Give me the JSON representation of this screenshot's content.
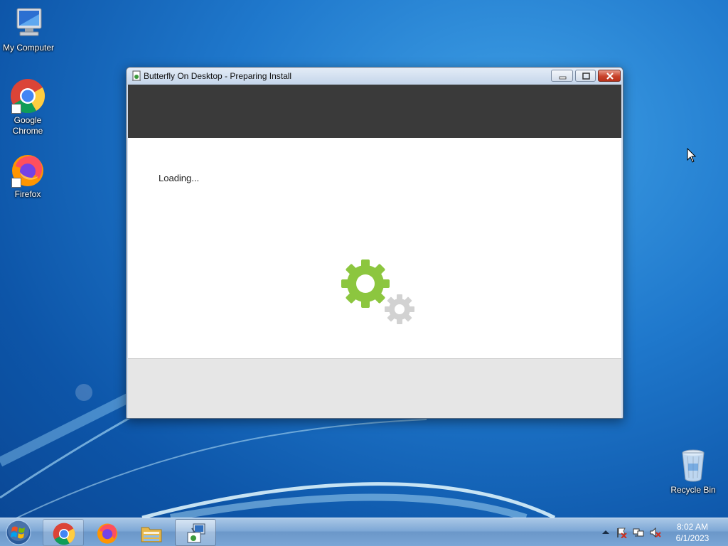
{
  "desktop": {
    "icons": [
      {
        "label": "My Computer",
        "icon": "computer-icon"
      },
      {
        "label": "Google Chrome",
        "icon": "chrome-icon"
      },
      {
        "label": "Firefox",
        "icon": "firefox-icon"
      },
      {
        "label": "Recycle Bin",
        "icon": "recycle-bin-icon"
      }
    ]
  },
  "window": {
    "title": "Butterfly On Desktop - Preparing Install",
    "status_text": "Loading...",
    "controls": [
      "minimize",
      "maximize",
      "close"
    ]
  },
  "taskbar": {
    "start_icon": "windows-logo-icon",
    "pinned": [
      {
        "name": "Google Chrome",
        "icon": "chrome-icon"
      },
      {
        "name": "Firefox",
        "icon": "firefox-icon"
      },
      {
        "name": "Windows Explorer",
        "icon": "folder-icon"
      },
      {
        "name": "Butterfly On Desktop installer",
        "icon": "installer-icon",
        "active": true
      }
    ],
    "tray": {
      "icons": [
        "show-hidden-icons-arrow",
        "action-center-flag-icon",
        "network-icon",
        "volume-muted-icon"
      ],
      "time": "8:02 AM",
      "date": "6/1/2023"
    }
  },
  "colors": {
    "banner": "#3a3a3a",
    "gear_primary": "#8cc63f",
    "gear_secondary": "#d0d0d0",
    "footer": "#e6e6e6"
  }
}
